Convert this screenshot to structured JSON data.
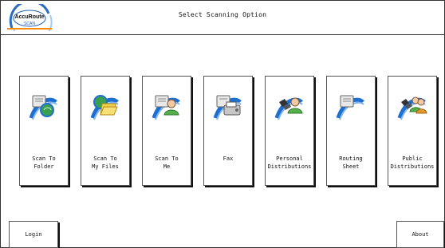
{
  "app": {
    "logo_text": "AccuRoute",
    "title": "Select Scanning Option"
  },
  "tiles": [
    {
      "label": "Scan To\nFolder",
      "icon": "scan-to-folder-icon"
    },
    {
      "label": "Scan To\nMy Files",
      "icon": "scan-to-my-files-icon"
    },
    {
      "label": "Scan To\nMe",
      "icon": "scan-to-me-icon"
    },
    {
      "label": "Fax",
      "icon": "fax-icon"
    },
    {
      "label": "Personal\nDistributions",
      "icon": "personal-distributions-icon"
    },
    {
      "label": "Routing\nSheet",
      "icon": "routing-sheet-icon"
    },
    {
      "label": "Public\nDistributions",
      "icon": "public-distributions-icon"
    }
  ],
  "footer": {
    "login_label": "Login",
    "about_label": "About"
  },
  "colors": {
    "arrow_blue": "#1f6fd1",
    "arrow_light": "#7fb3ee",
    "folder_yellow": "#f3d24b",
    "person_green": "#56b04a",
    "globe_green": "#3aa04f",
    "orange_ring": "#ff8c00"
  }
}
